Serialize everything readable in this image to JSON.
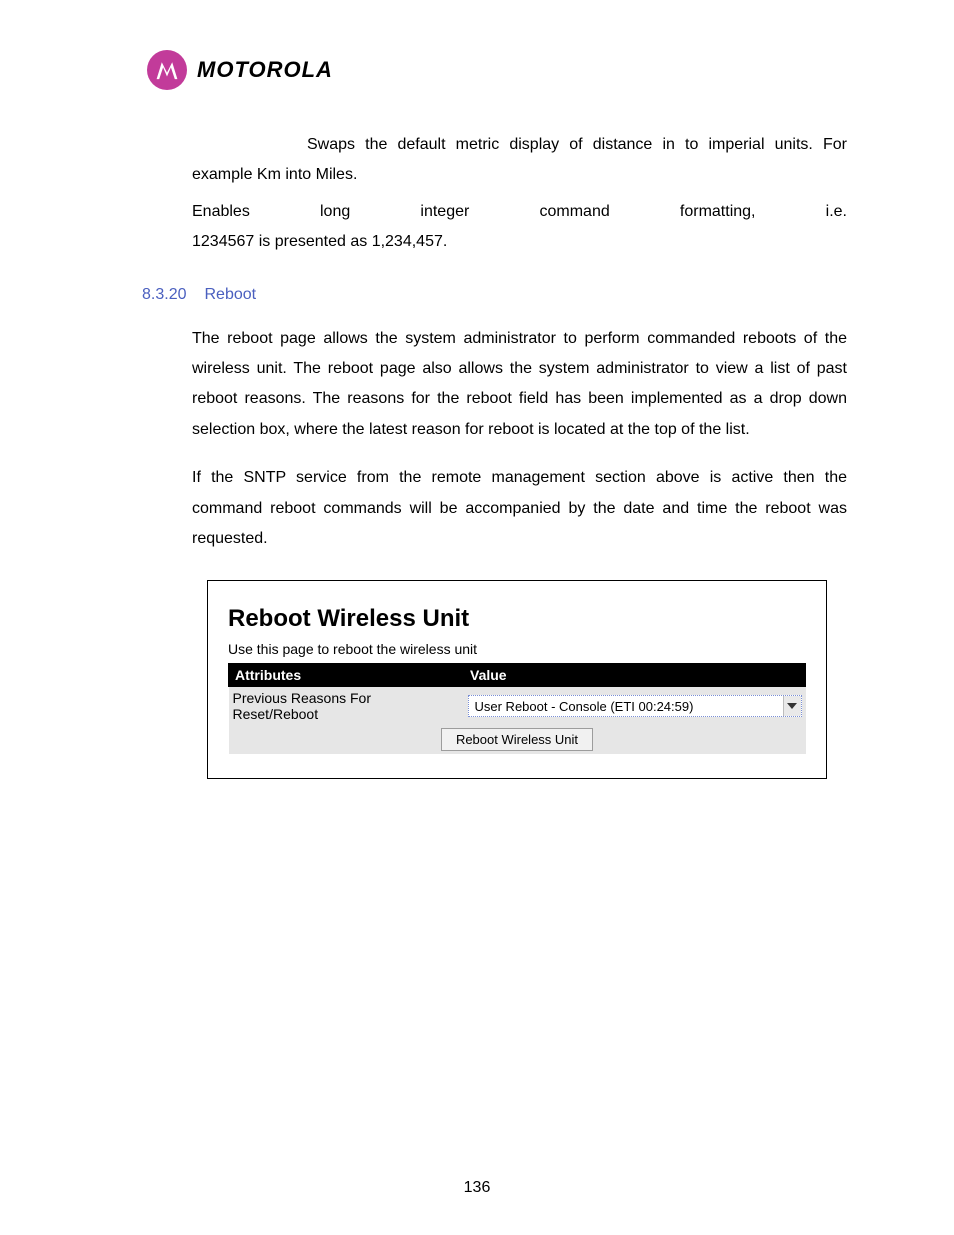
{
  "header": {
    "brand": "MOTOROLA"
  },
  "body": {
    "para1": "Swaps the default metric display of distance in to imperial units. For example Km into Miles.",
    "para2_lead": "Enables long integer command formatting, i.e.",
    "para2_rest": "1234567 is presented as 1,234,457.",
    "section_number": "8.3.20",
    "section_title": "Reboot",
    "para3": "The reboot page allows the system administrator to perform commanded reboots of the wireless unit. The reboot page also allows the system administrator to view a list of past reboot reasons. The reasons for the reboot field has been implemented as a drop down selection box, where the latest reason for reboot is located at the top of the list.",
    "para4": "If the SNTP service from the remote management section above is active then the command reboot commands will be accompanied by the date and time the reboot was requested."
  },
  "screenshot": {
    "title": "Reboot Wireless Unit",
    "subtitle": "Use this page to reboot the wireless unit",
    "table": {
      "header_attr": "Attributes",
      "header_val": "Value",
      "row_label": "Previous Reasons For Reset/Reboot",
      "row_value": "User Reboot - Console (ETI 00:24:59)"
    },
    "button_label": "Reboot Wireless Unit"
  },
  "page_number": "136"
}
